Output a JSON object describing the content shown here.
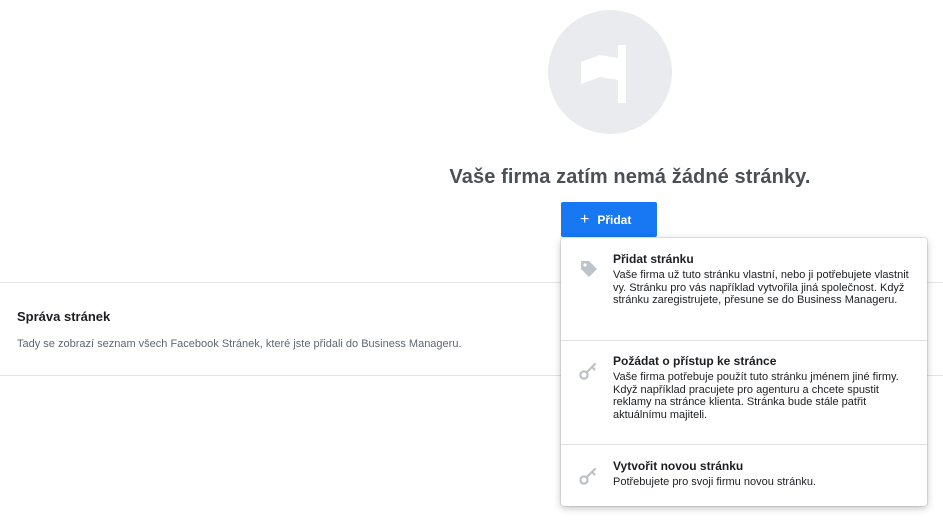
{
  "empty_state": {
    "title": "Vaše firma zatím nemá žádné stránky.",
    "add_button_label": "Přidat",
    "add_button_icon": "plus-icon",
    "illustration_icon": "flag-icon"
  },
  "section": {
    "title": "Správa stránek",
    "description": "Tady se zobrazí seznam všech Facebook Stránek, které jste přidali do Business Manageru."
  },
  "menu": {
    "items": [
      {
        "icon": "tag-icon",
        "title": "Přidat stránku",
        "description": "Vaše firma už tuto stránku vlastní, nebo ji potřebujete vlastnit vy. Stránku pro vás například vytvořila jiná společnost. Když stránku zaregistrujete, přesune se do Business Manageru."
      },
      {
        "icon": "key-icon",
        "title": "Požádat o přístup ke stránce",
        "description": "Vaše firma potřebuje použít tuto stránku jménem jiné firmy. Když například pracujete pro agenturu a chcete spustit reklamy na stránce klienta. Stránka bude stále patřit aktuálnímu majiteli."
      },
      {
        "icon": "key-icon",
        "title": "Vytvořit novou stránku",
        "description": "Potřebujete pro svoji firmu novou stránku."
      }
    ]
  },
  "colors": {
    "accent": "#1877f2",
    "icon_gray": "#bec3c9",
    "illustration_bg": "#e9ebee"
  }
}
